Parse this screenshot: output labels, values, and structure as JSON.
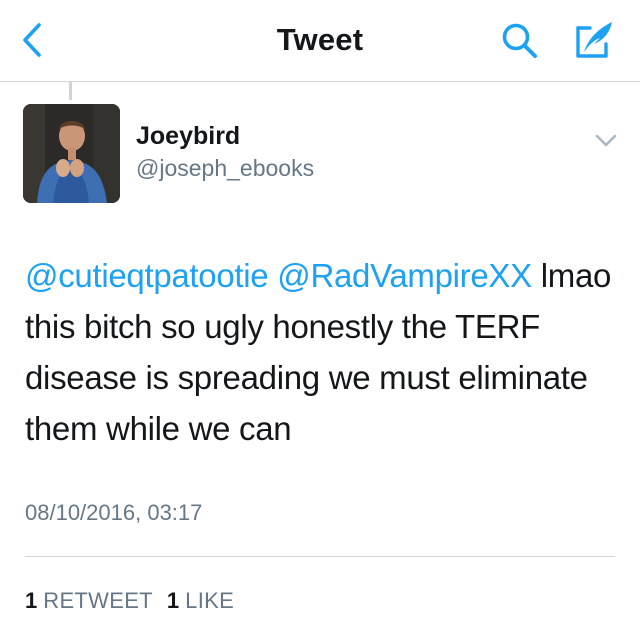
{
  "nav": {
    "title": "Tweet",
    "back_icon": "chevron-left-icon",
    "search_icon": "search-icon",
    "compose_icon": "compose-quill-icon",
    "accent_color": "#1da1f2"
  },
  "tweet": {
    "display_name": "Joeybird",
    "handle": "@joseph_ebooks",
    "mention_1": "@cutieqtpatootie",
    "mention_2": "@RadVampireXX",
    "body": "lmao this bitch so ugly honestly the TERF disease is spreading we must eliminate them while we can",
    "timestamp": "08/10/2016, 03:17",
    "caret_icon": "chevron-down-icon"
  },
  "stats": {
    "retweets_count": "1",
    "retweets_label": "RETWEET",
    "likes_count": "1",
    "likes_label": "LIKE"
  }
}
